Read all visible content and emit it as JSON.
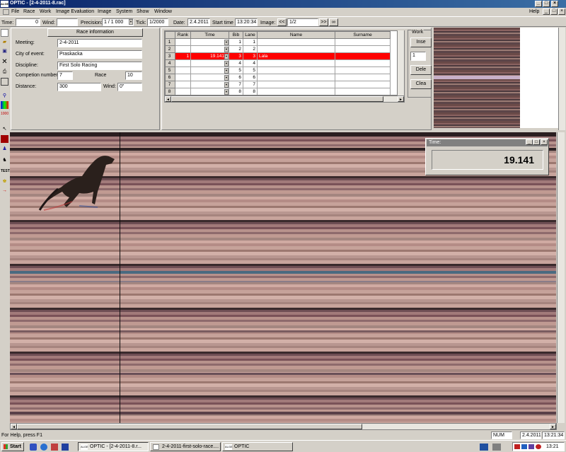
{
  "window": {
    "title": "OPTIC - [2-4-2011-8.rac]",
    "app_icon": "ALGE",
    "min": "_",
    "max": "□",
    "close": "×"
  },
  "menu": [
    "File",
    "Race",
    "Work",
    "Image Evaluation",
    "Image",
    "System",
    "Show",
    "Window"
  ],
  "menu_help": "Help",
  "toolbar": {
    "time_label": "Time:",
    "time_value": "0",
    "wind_label": "Wind:",
    "wind_value": "",
    "precision_label": "Precision:",
    "precision_value": "1 / 1 000",
    "tick_label": "Tick:",
    "tick_value": "1/2000",
    "date_label": "Date:",
    "date_value": "2.4.2011",
    "start_label": "Start time",
    "start_value": "13:20:34",
    "image_label": "Image:",
    "prev": "<<",
    "image_value": "1/2",
    "next": ">>",
    "loop": "∞"
  },
  "race_info": {
    "header": "Race information",
    "meeting_label": "Meeting:",
    "meeting": "2-4-2011",
    "city_label": "City of event:",
    "city": "Praskacka",
    "discipline_label": "Discipline:",
    "discipline": "First Solo Racing",
    "comp_label": "Competion number:",
    "comp": "7",
    "race_label": "Race",
    "race": "10",
    "distance_label": "Distance:",
    "distance": "300",
    "wind_label": "Wind:",
    "wind": "0\""
  },
  "results": {
    "columns": [
      "Rank",
      "Time",
      "Bib",
      "Lane",
      "Name",
      "Surname"
    ],
    "rows": [
      {
        "n": "1",
        "rank": "",
        "time": "",
        "bib": "1",
        "lane": "1",
        "name": ""
      },
      {
        "n": "2",
        "rank": "",
        "time": "",
        "bib": "2",
        "lane": "2",
        "name": ""
      },
      {
        "n": "3",
        "rank": "1",
        "time": "19.141",
        "bib": "3",
        "lane": "3",
        "name": "Lala"
      },
      {
        "n": "4",
        "rank": "",
        "time": "",
        "bib": "4",
        "lane": "4",
        "name": ""
      },
      {
        "n": "5",
        "rank": "",
        "time": "",
        "bib": "5",
        "lane": "5",
        "name": ""
      },
      {
        "n": "6",
        "rank": "",
        "time": "",
        "bib": "6",
        "lane": "6",
        "name": ""
      },
      {
        "n": "7",
        "rank": "",
        "time": "",
        "bib": "7",
        "lane": "7",
        "name": ""
      },
      {
        "n": "8",
        "rank": "",
        "time": "",
        "bib": "8",
        "lane": "8",
        "name": ""
      }
    ]
  },
  "work": {
    "title": "Work",
    "insert": "Inse",
    "spin": "1",
    "delete": "Dele",
    "clear": "Clea"
  },
  "time_window": {
    "title": "Time:",
    "value": "19.141"
  },
  "status": {
    "help": "For Help, press F1",
    "num": "NUM",
    "date": "2.4.2011",
    "time": "13:21:34"
  },
  "taskbar": {
    "start": "Start",
    "tasks": [
      "OPTIC - [2-4-2011-8.r...",
      "2-4-2011-first-solo-race....",
      "OPTIC"
    ],
    "clock": "13:21"
  },
  "tools": [
    "new",
    "open",
    "save",
    "delete",
    "print",
    "preview",
    "zoom",
    "color",
    "1000",
    "pointer",
    "red-flag",
    "runner-blue",
    "dog",
    "TEST",
    "runner-yellow",
    "arrow-red"
  ]
}
